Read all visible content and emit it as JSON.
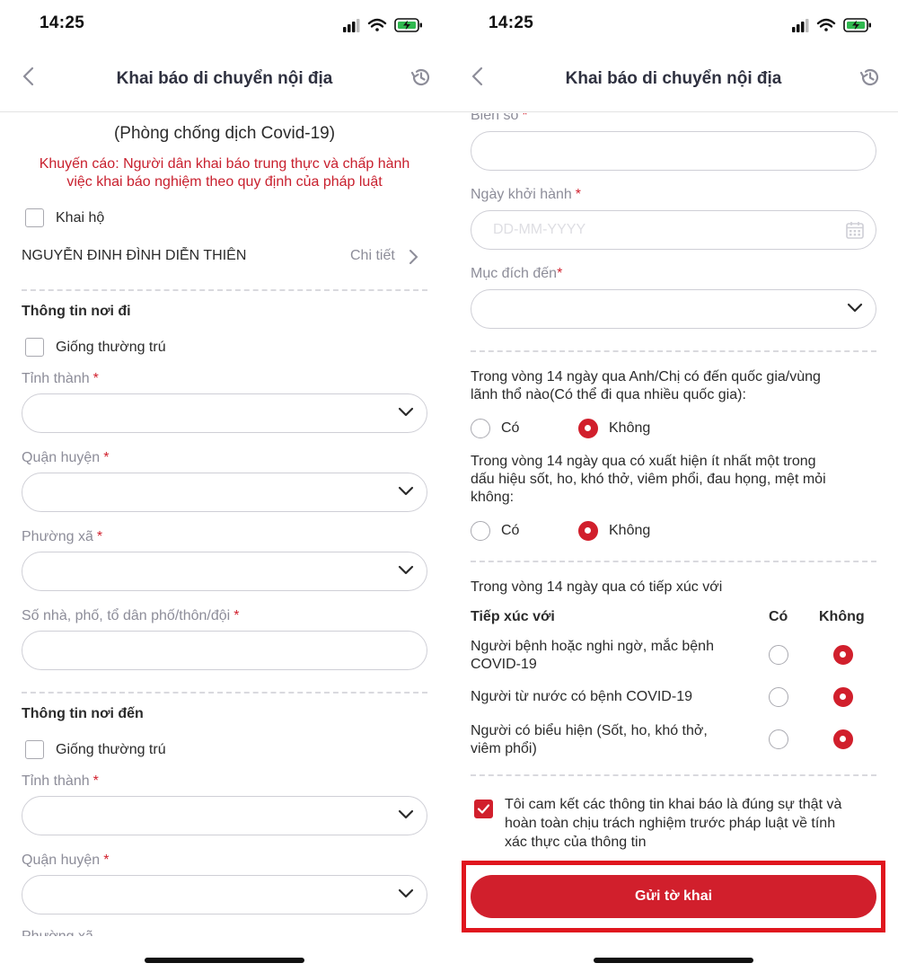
{
  "status": {
    "time": "14:25"
  },
  "nav": {
    "title": "Khai báo di chuyển nội địa"
  },
  "left": {
    "subtitle": "(Phòng chống dịch Covid-19)",
    "warning_line1": "Khuyến cáo: Người dân khai báo trung thực và chấp hành",
    "warning_line2": "việc khai báo nghiệm theo quy định của pháp luật",
    "khai_ho": "Khai hộ",
    "person_name": "NGUYỄN ĐINH ĐÌNH DIỄN THIÊN",
    "detail_link": "Chi tiết",
    "origin": {
      "title": "Thông tin nơi đi",
      "same_residence": "Giống thường trú",
      "province": "Tỉnh thành",
      "district": "Quận huyện",
      "ward": "Phường xã",
      "address": "Số nhà, phố, tổ dân phố/thôn/đội"
    },
    "destination": {
      "title": "Thông tin nơi đến",
      "same_residence": "Giống thường trú",
      "province": "Tỉnh thành",
      "district": "Quận huyện",
      "ward_partial": "Phường xã"
    }
  },
  "right": {
    "plate_label": "Biển số",
    "departure_label": "Ngày khởi hành",
    "departure_placeholder": "DD-MM-YYYY",
    "purpose_label": "Mục đích đến",
    "q1_line1": "Trong vòng 14 ngày qua Anh/Chị có đến quốc gia/vùng",
    "q1_line2": "lãnh thổ nào(Có thể đi qua nhiều quốc gia):",
    "q2_line1": "Trong vòng 14 ngày qua có xuất hiện ít nhất một trong",
    "q2_line2": "dấu hiệu sốt, ho, khó thở, viêm phổi, đau họng, mệt mỏi",
    "q2_line3": "không:",
    "yes": "Có",
    "no": "Không",
    "contact_intro": "Trong vòng 14 ngày qua có tiếp xúc với",
    "contact_header": {
      "col1": "Tiếp xúc với",
      "col2": "Có",
      "col3": "Không"
    },
    "contacts": [
      {
        "line1": "Người bệnh hoặc nghi ngờ, mắc bệnh",
        "line2": "COVID-19"
      },
      {
        "line1": "Người từ nước có bệnh COVID-19",
        "line2": ""
      },
      {
        "line1": "Người có biểu hiện (Sốt, ho, khó thở,",
        "line2": "viêm phổi)"
      }
    ],
    "commit_line1": "Tôi cam kết các thông tin khai báo là đúng sự thật và",
    "commit_line2": "hoàn toàn chịu trách nghiệm trước pháp luật về tính",
    "commit_line3": "xác thực của thông tin",
    "submit": "Gửi tờ khai"
  },
  "colors": {
    "accent": "#d11f2c",
    "highlight": "#e0161e",
    "border": "#cfcfd6"
  }
}
